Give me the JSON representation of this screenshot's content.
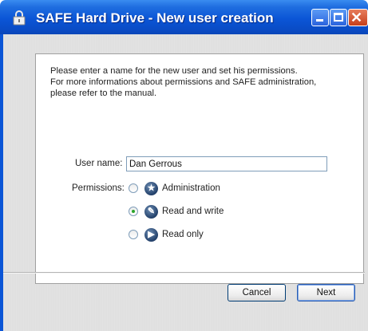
{
  "window": {
    "title": "SAFE Hard Drive - New user creation",
    "icons": {
      "app": "padlock-icon",
      "minimize": "minimize-icon",
      "maximize": "maximize-icon",
      "close": "close-icon"
    }
  },
  "intro": {
    "lines": [
      "Please enter a name for the new user and set his permissions.",
      "For more informations about permissions and SAFE administration,",
      "please refer to the manual."
    ]
  },
  "form": {
    "username_label": "User name:",
    "username_value": "Dan Gerrous",
    "permissions_label": "Permissions:",
    "options": [
      {
        "label": "Administration",
        "selected": false,
        "icon": "administration-icon"
      },
      {
        "label": "Read and write",
        "selected": true,
        "icon": "read-write-icon"
      },
      {
        "label": "Read only",
        "selected": false,
        "icon": "read-only-icon"
      }
    ]
  },
  "buttons": {
    "cancel": "Cancel",
    "next": "Next"
  },
  "colors": {
    "titlebar": "#0b55d6",
    "close": "#c63f1b",
    "radio_selected": "#2aa52a"
  }
}
